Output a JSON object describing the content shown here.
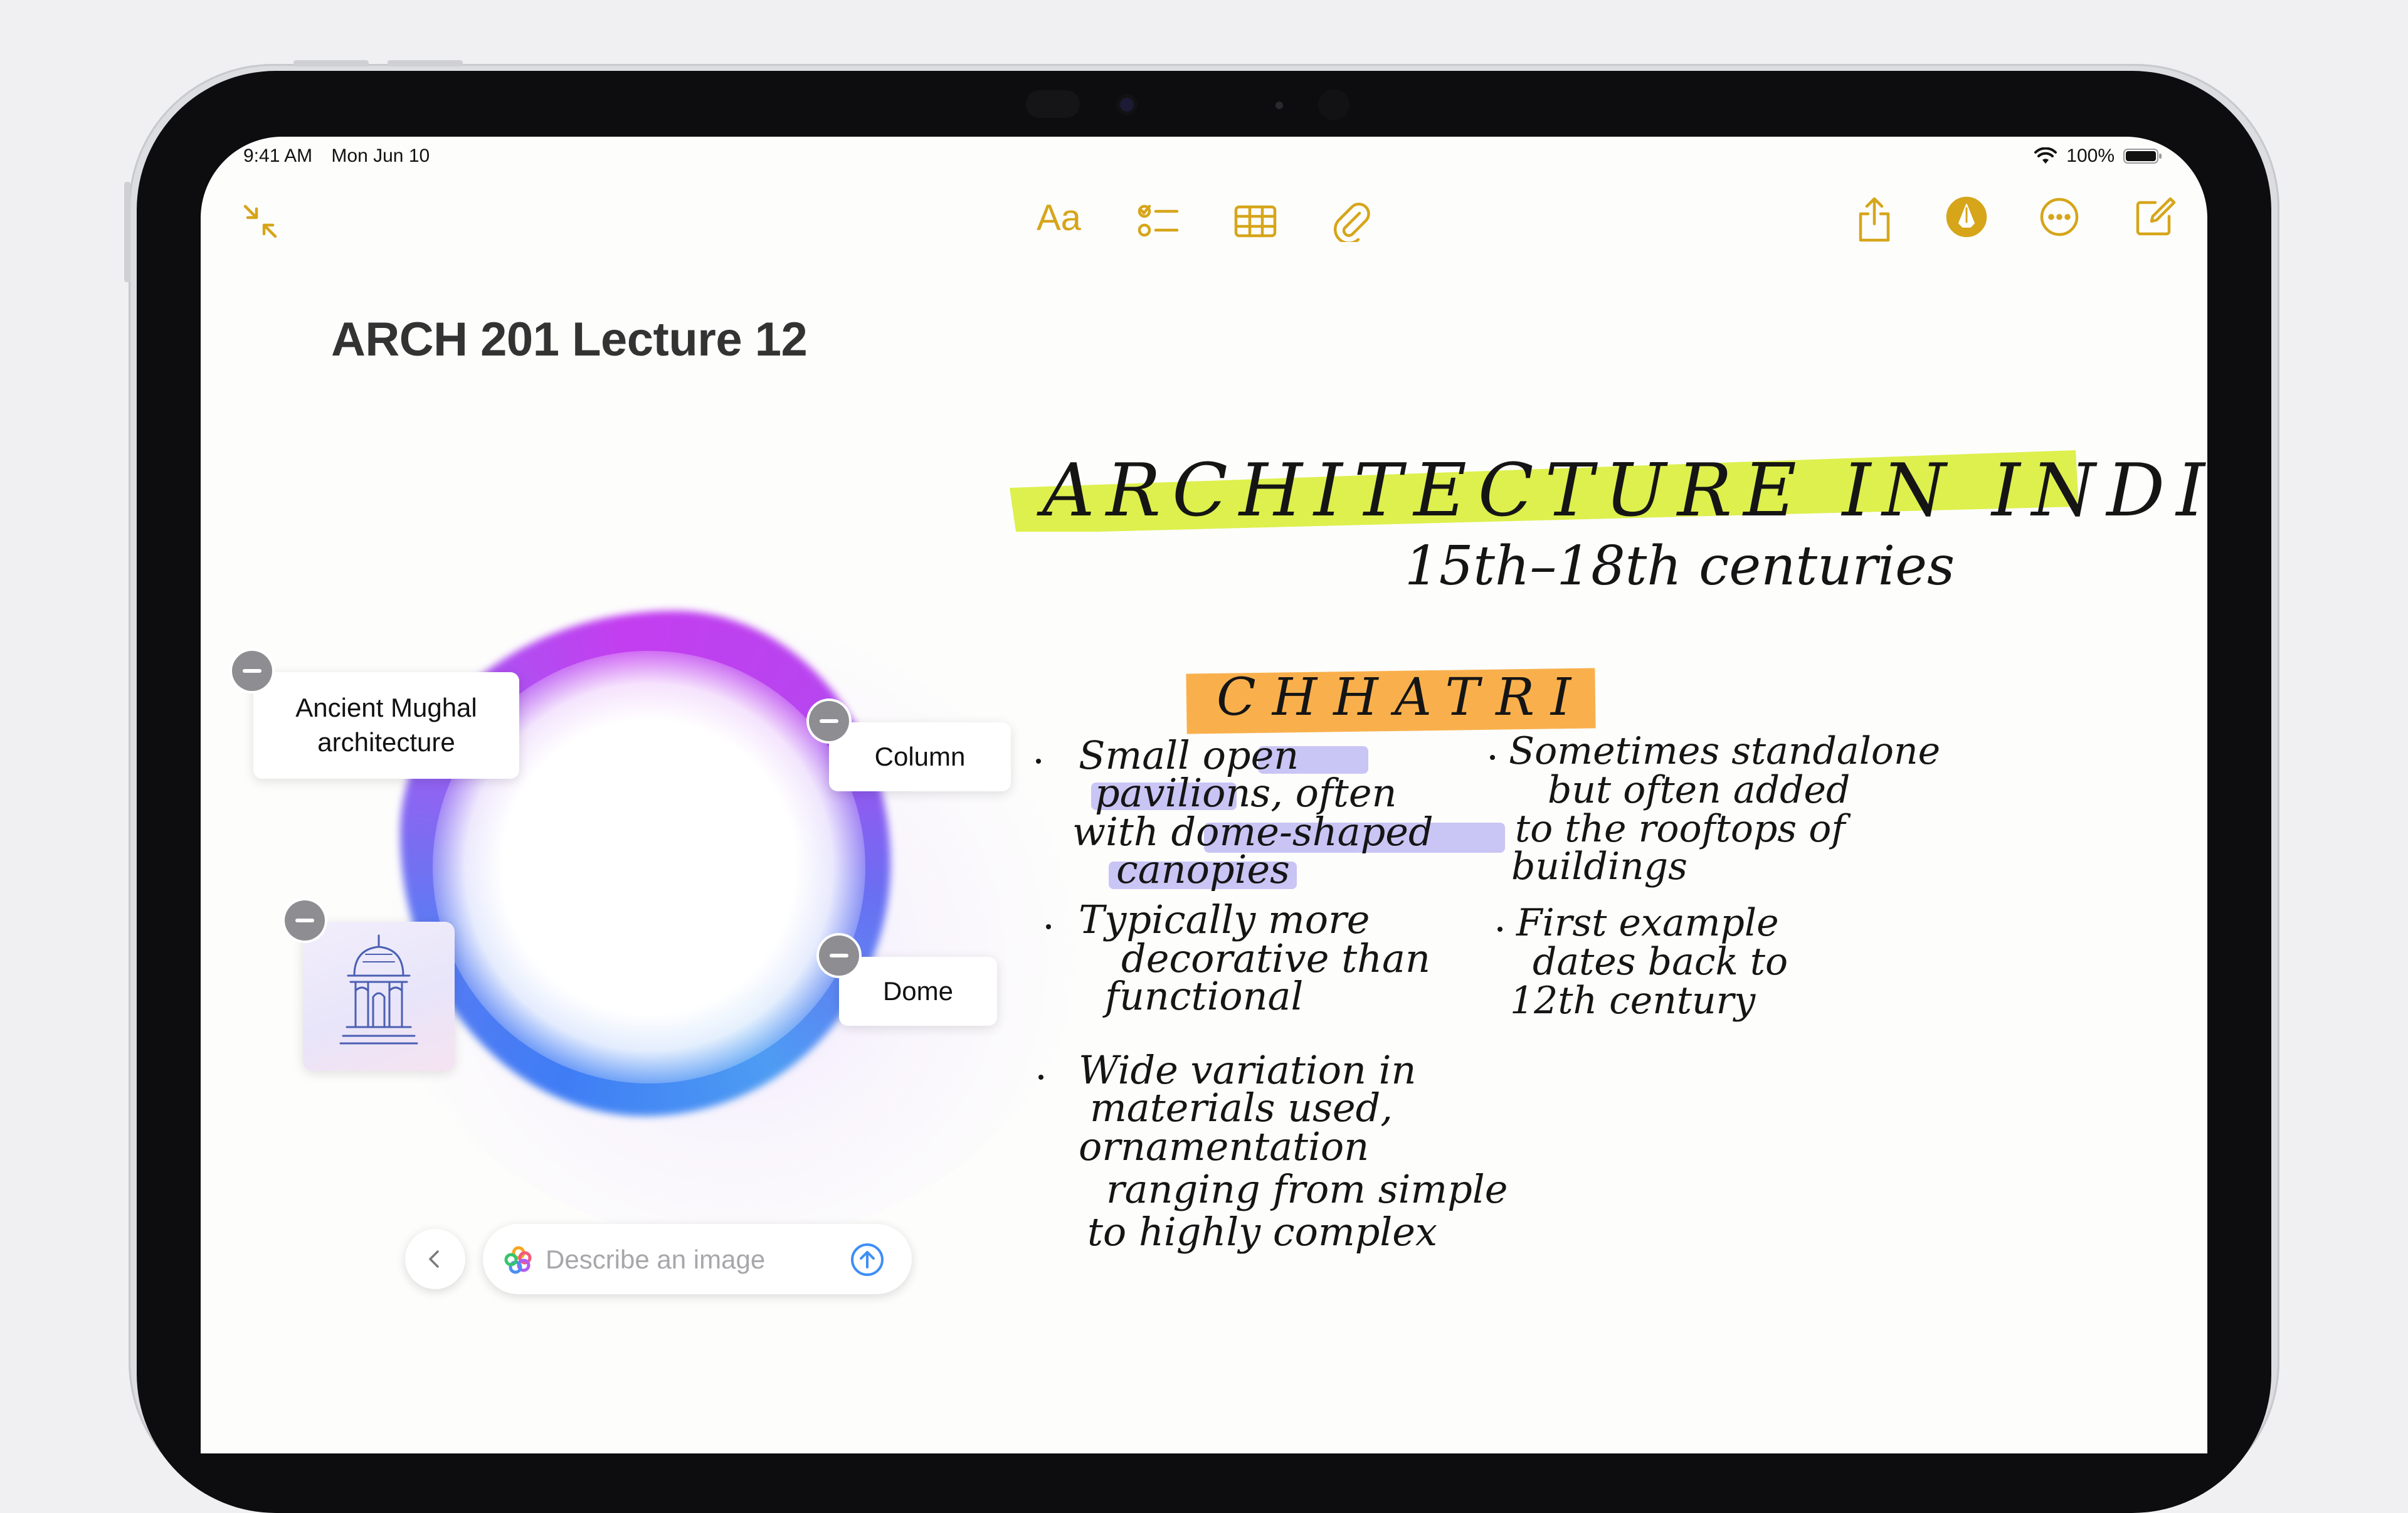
{
  "status_bar": {
    "time": "9:41 AM",
    "date": "Mon Jun 10",
    "battery": "100%"
  },
  "toolbar": {
    "collapse_icon": "arrows-in-icon",
    "format_label": "Aa",
    "checklist_icon": "checklist-icon",
    "table_icon": "table-icon",
    "attachment_icon": "paperclip-icon",
    "share_icon": "share-icon",
    "markup_icon": "pen-circle-icon",
    "more_icon": "ellipsis-circle-icon",
    "compose_icon": "compose-icon",
    "accent_color": "#d6a51a"
  },
  "note": {
    "title": "ARCH 201 Lecture 12"
  },
  "image_playground": {
    "concepts": [
      {
        "label": "Ancient Mughal architecture"
      },
      {
        "label": "Column"
      },
      {
        "label": "Dome"
      }
    ],
    "image_chip": "chhatri-sketch-icon",
    "prompt_placeholder": "Describe an image"
  },
  "handwriting": {
    "heading": "ARCHITECTURE IN INDIA",
    "subheading": "15th–18th centuries",
    "section": "CHHATRI",
    "bullets_left": [
      [
        "Small open",
        "pavilions, often",
        "with dome-shaped",
        "canopies"
      ],
      [
        "Typically more",
        "decorative than",
        "functional"
      ],
      [
        "Wide variation in",
        "materials used,",
        "ornamentation",
        "ranging from simple",
        "to highly complex"
      ]
    ],
    "bullets_right": [
      [
        "Sometimes standalone",
        "but often added",
        "to the rooftops of",
        "buildings"
      ],
      [
        "First example",
        "dates back to",
        "12th century"
      ]
    ],
    "highlight_colors": {
      "heading": "#d9ee3a",
      "section": "#f8a533",
      "phrase": "#b7b2f2"
    }
  }
}
